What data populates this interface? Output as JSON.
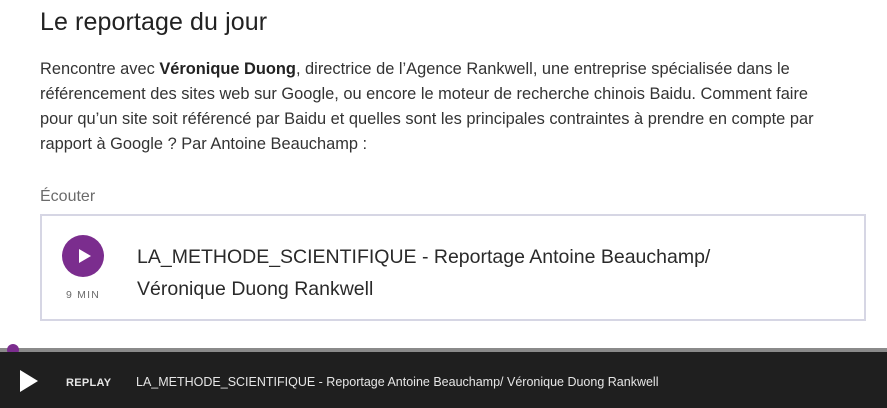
{
  "section": {
    "title": "Le reportage du jour"
  },
  "intro": {
    "prefix": "Rencontre avec ",
    "person": "Véronique Duong",
    "rest": ", directrice de l’Agence Rankwell, une entreprise spécialisée dans le référencement des sites web sur Google, ou encore le moteur de recherche chinois Baidu. Comment faire pour qu’un site soit référencé par Baidu et quelles sont les principales contraintes à prendre en compte par rapport à Google ? Par Antoine Beauchamp :"
  },
  "listen": {
    "label": "Écouter"
  },
  "episode": {
    "title": "LA_METHODE_SCIENTIFIQUE - Reportage Antoine Beauchamp/ Véronique Duong Rankwell",
    "duration": "9 MIN",
    "play_icon": "play-icon"
  },
  "player": {
    "replay_label": "REPLAY",
    "title": "LA_METHODE_SCIENTIFIQUE - Reportage Antoine Beauchamp/ Véronique Duong Rankwell",
    "progress": 0.01
  },
  "colors": {
    "accent": "#7b2d8e",
    "player_bg": "#1f1f1f",
    "card_border": "#d6d6e4"
  }
}
